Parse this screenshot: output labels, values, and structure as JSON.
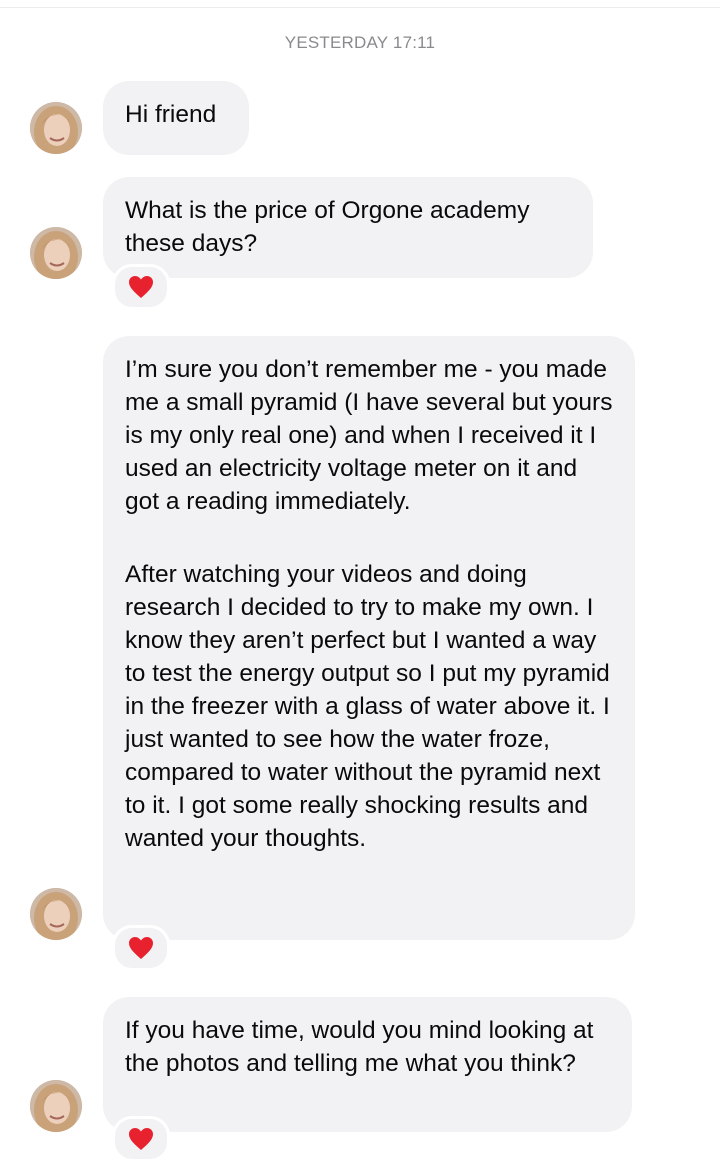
{
  "header": {
    "timestamp": "YESTERDAY 17:11"
  },
  "messages": [
    {
      "avatar": "sender-avatar",
      "paragraphs": [
        "Hi friend"
      ],
      "reaction": null
    },
    {
      "avatar": "sender-avatar",
      "paragraphs": [
        "What is the price of Orgone academy these days?"
      ],
      "reaction": "red-heart-icon"
    },
    {
      "avatar": "sender-avatar",
      "paragraphs": [
        "I’m sure you don’t remember me - you made me a small pyramid (I have several but yours is my only real one) and when I received it I used an electricity voltage meter on it and got a reading immediately.",
        "After watching your videos and doing research I decided to try to make my own. I know they aren’t perfect but I wanted a way to test the energy output so I put my pyramid in the freezer with a glass of water above it. I just wanted to see how the water froze, compared to water without the pyramid next to it. I got some really shocking results and wanted your thoughts."
      ],
      "reaction": "red-heart-icon"
    },
    {
      "avatar": "sender-avatar",
      "paragraphs": [
        "If you have time, would you mind looking at the photos and telling me what you think?"
      ],
      "reaction": "red-heart-icon"
    }
  ],
  "colors": {
    "bubble": "#f2f2f4",
    "heart": "#e8212e",
    "timestamp": "#8a8a8e"
  }
}
